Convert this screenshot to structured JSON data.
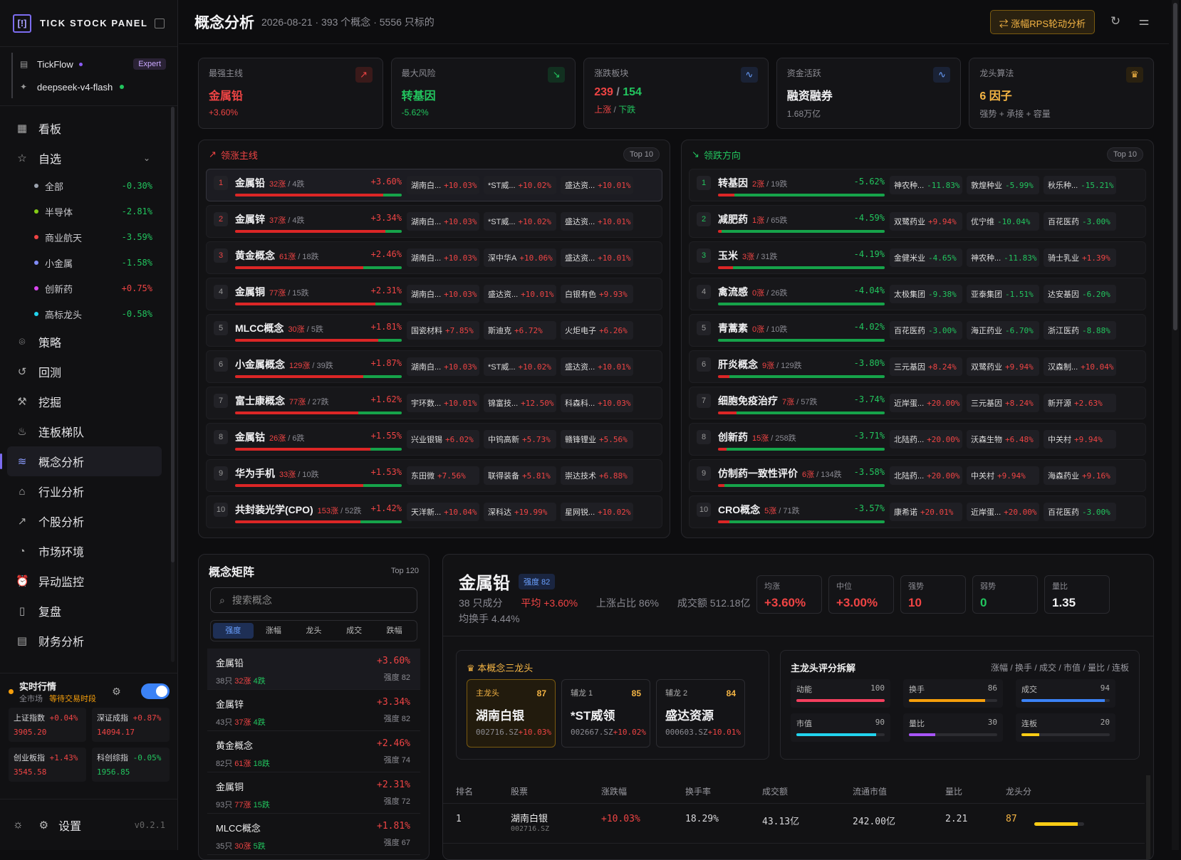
{
  "brand": {
    "logo": "[!]",
    "name": "TICK STOCK PANEL"
  },
  "accounts": [
    {
      "icon": "db-icon",
      "name": "TickFlow",
      "badge": "Expert"
    },
    {
      "icon": "model-icon",
      "name": "deepseek-v4-flash"
    }
  ],
  "nav": {
    "top": [
      {
        "icon": "grid-icon",
        "label": "看板"
      },
      {
        "icon": "star-icon",
        "label": "自选"
      }
    ],
    "watch": [
      {
        "label": "全部",
        "color": "#9ca3af",
        "value": "-0.30%"
      },
      {
        "label": "半导体",
        "color": "#84cc16",
        "value": "-2.81%"
      },
      {
        "label": "商业航天",
        "color": "#ef4444",
        "value": "-3.59%"
      },
      {
        "label": "小金属",
        "color": "#818cf8",
        "value": "-1.58%"
      },
      {
        "label": "创新药",
        "color": "#d946ef",
        "value": "+0.75%"
      },
      {
        "label": "高标龙头",
        "color": "#22d3ee",
        "value": "-0.58%"
      }
    ],
    "rest": [
      {
        "icon": "strategy-icon",
        "label": "策略"
      },
      {
        "icon": "history-icon",
        "label": "回测"
      },
      {
        "icon": "mining-icon",
        "label": "挖掘"
      },
      {
        "icon": "fire-icon",
        "label": "连板梯队"
      },
      {
        "icon": "layers-icon",
        "label": "概念分析"
      },
      {
        "icon": "bank-icon",
        "label": "行业分析"
      },
      {
        "icon": "trend-icon",
        "label": "个股分析"
      },
      {
        "icon": "gauge-icon",
        "label": "市场环境"
      },
      {
        "icon": "alarm-icon",
        "label": "异动监控"
      },
      {
        "icon": "book-icon",
        "label": "复盘"
      },
      {
        "icon": "file-icon",
        "label": "财务分析"
      }
    ],
    "active": "概念分析"
  },
  "realtime": {
    "title": "实时行情",
    "scope": "全市场",
    "status": "等待交易时段",
    "indices": [
      {
        "name": "上证指数",
        "chg": "+0.04%",
        "val": "3905.20"
      },
      {
        "name": "深证成指",
        "chg": "+0.87%",
        "val": "14094.17"
      },
      {
        "name": "创业板指",
        "chg": "+1.43%",
        "val": "3545.58"
      },
      {
        "name": "科创综指",
        "chg": "-0.05%",
        "val": "1956.85"
      }
    ]
  },
  "footer": {
    "settings": "设置",
    "version": "v0.2.1"
  },
  "header": {
    "title": "概念分析",
    "meta": "2026-08-21 · 393 个概念 · 5556 只标的",
    "rps_button": "涨幅RPS轮动分析"
  },
  "cards": [
    {
      "label": "最强主线",
      "value": "金属铅",
      "sub": "+3.60%",
      "icon": "up-trend-icon",
      "vcolor": "#ef4444",
      "scolor": "#ef4444"
    },
    {
      "label": "最大风险",
      "value": "转基因",
      "sub": "-5.62%",
      "icon": "down-trend-icon",
      "vcolor": "#22c55e",
      "scolor": "#22c55e"
    },
    {
      "label": "涨跌板块",
      "value": "239 / 154",
      "up": "239",
      "down": "154",
      "sub_up": "上涨",
      "sub_down": "下跌",
      "icon": "pulse-icon"
    },
    {
      "label": "资金活跃",
      "value": "融资融券",
      "sub": "1.68万亿",
      "icon": "pulse-icon",
      "vcolor": "#f1f1f3",
      "scolor": "#8c8c93"
    },
    {
      "label": "龙头算法",
      "value": "6 因子",
      "sub": "强势 + 承接 + 容量",
      "icon": "crown-icon",
      "vcolor": "#f5b544",
      "scolor": "#8c8c93"
    }
  ],
  "leaders": {
    "title": "领涨主线",
    "top": "Top 10",
    "rows": [
      {
        "rank": "1",
        "name": "金属铅",
        "up": "32涨",
        "down": "4跌",
        "pct": "+3.60%",
        "ratio": 0.89,
        "stocks": [
          [
            "湖南白...",
            "+10.03%"
          ],
          [
            "*ST威...",
            "+10.02%"
          ],
          [
            "盛达资...",
            "+10.01%"
          ]
        ]
      },
      {
        "rank": "2",
        "name": "金属锌",
        "up": "37涨",
        "down": "4跌",
        "pct": "+3.34%",
        "ratio": 0.9,
        "stocks": [
          [
            "湖南白...",
            "+10.03%"
          ],
          [
            "*ST威...",
            "+10.02%"
          ],
          [
            "盛达资...",
            "+10.01%"
          ]
        ]
      },
      {
        "rank": "3",
        "name": "黄金概念",
        "up": "61涨",
        "down": "18跌",
        "pct": "+2.46%",
        "ratio": 0.77,
        "stocks": [
          [
            "湖南白...",
            "+10.03%"
          ],
          [
            "深中华A",
            "+10.06%"
          ],
          [
            "盛达资...",
            "+10.01%"
          ]
        ]
      },
      {
        "rank": "4",
        "name": "金属铜",
        "up": "77涨",
        "down": "15跌",
        "pct": "+2.31%",
        "ratio": 0.84,
        "stocks": [
          [
            "湖南白...",
            "+10.03%"
          ],
          [
            "盛达资...",
            "+10.01%"
          ],
          [
            "白银有色",
            "+9.93%"
          ]
        ]
      },
      {
        "rank": "5",
        "name": "MLCC概念",
        "up": "30涨",
        "down": "5跌",
        "pct": "+1.81%",
        "ratio": 0.86,
        "stocks": [
          [
            "国瓷材料",
            "+7.85%"
          ],
          [
            "斯迪克",
            "+6.72%"
          ],
          [
            "火炬电子",
            "+6.26%"
          ]
        ]
      },
      {
        "rank": "6",
        "name": "小金属概念",
        "up": "129涨",
        "down": "39跌",
        "pct": "+1.87%",
        "ratio": 0.77,
        "stocks": [
          [
            "湖南白...",
            "+10.03%"
          ],
          [
            "*ST威...",
            "+10.02%"
          ],
          [
            "盛达资...",
            "+10.01%"
          ]
        ]
      },
      {
        "rank": "7",
        "name": "富士康概念",
        "up": "77涨",
        "down": "27跌",
        "pct": "+1.62%",
        "ratio": 0.74,
        "stocks": [
          [
            "宇环数...",
            "+10.01%"
          ],
          [
            "锦富技...",
            "+12.50%"
          ],
          [
            "科森科...",
            "+10.03%"
          ]
        ]
      },
      {
        "rank": "8",
        "name": "金属钴",
        "up": "26涨",
        "down": "6跌",
        "pct": "+1.55%",
        "ratio": 0.81,
        "stocks": [
          [
            "兴业银锡",
            "+6.02%"
          ],
          [
            "中钨高新",
            "+5.73%"
          ],
          [
            "赣锋锂业",
            "+5.56%"
          ]
        ]
      },
      {
        "rank": "9",
        "name": "华为手机",
        "up": "33涨",
        "down": "10跌",
        "pct": "+1.53%",
        "ratio": 0.77,
        "stocks": [
          [
            "东田微",
            "+7.56%"
          ],
          [
            "联得装备",
            "+5.81%"
          ],
          [
            "崇达技术",
            "+6.88%"
          ]
        ]
      },
      {
        "rank": "10",
        "name": "共封装光学(CPO)",
        "up": "153涨",
        "down": "52跌",
        "pct": "+1.42%",
        "ratio": 0.75,
        "stocks": [
          [
            "天洋新...",
            "+10.04%"
          ],
          [
            "深科达",
            "+19.99%"
          ],
          [
            "星网锐...",
            "+10.02%"
          ]
        ]
      }
    ]
  },
  "losers": {
    "title": "领跌方向",
    "top": "Top 10",
    "rows": [
      {
        "rank": "1",
        "name": "转基因",
        "up": "2涨",
        "down": "19跌",
        "pct": "-5.62%",
        "ratio": 0.1,
        "stocks": [
          [
            "神农种...",
            "-11.83%"
          ],
          [
            "敦煌种业",
            "-5.99%"
          ],
          [
            "秋乐种...",
            "-15.21%"
          ]
        ]
      },
      {
        "rank": "2",
        "name": "减肥药",
        "up": "1涨",
        "down": "65跌",
        "pct": "-4.59%",
        "ratio": 0.02,
        "stocks": [
          [
            "双鹭药业",
            "+9.94%"
          ],
          [
            "优宁维",
            "-10.04%"
          ],
          [
            "百花医药",
            "-3.00%"
          ]
        ]
      },
      {
        "rank": "3",
        "name": "玉米",
        "up": "3涨",
        "down": "31跌",
        "pct": "-4.19%",
        "ratio": 0.09,
        "stocks": [
          [
            "金健米业",
            "-4.65%"
          ],
          [
            "神农种...",
            "-11.83%"
          ],
          [
            "骑士乳业",
            "+1.39%"
          ]
        ]
      },
      {
        "rank": "4",
        "name": "禽流感",
        "up": "0涨",
        "down": "26跌",
        "pct": "-4.04%",
        "ratio": 0.0,
        "stocks": [
          [
            "太极集团",
            "-9.38%"
          ],
          [
            "亚泰集团",
            "-1.51%"
          ],
          [
            "达安基因",
            "-6.20%"
          ]
        ]
      },
      {
        "rank": "5",
        "name": "青蒿素",
        "up": "0涨",
        "down": "10跌",
        "pct": "-4.02%",
        "ratio": 0.0,
        "stocks": [
          [
            "百花医药",
            "-3.00%"
          ],
          [
            "海正药业",
            "-6.70%"
          ],
          [
            "浙江医药",
            "-8.88%"
          ]
        ]
      },
      {
        "rank": "6",
        "name": "肝炎概念",
        "up": "9涨",
        "down": "129跌",
        "pct": "-3.80%",
        "ratio": 0.07,
        "stocks": [
          [
            "三元基因",
            "+8.24%"
          ],
          [
            "双鹭药业",
            "+9.94%"
          ],
          [
            "汉森制...",
            "+10.04%"
          ]
        ]
      },
      {
        "rank": "7",
        "name": "细胞免疫治疗",
        "up": "7涨",
        "down": "57跌",
        "pct": "-3.74%",
        "ratio": 0.11,
        "stocks": [
          [
            "近岸蛋...",
            "+20.00%"
          ],
          [
            "三元基因",
            "+8.24%"
          ],
          [
            "新开源",
            "+2.63%"
          ]
        ]
      },
      {
        "rank": "8",
        "name": "创新药",
        "up": "15涨",
        "down": "258跌",
        "pct": "-3.71%",
        "ratio": 0.05,
        "stocks": [
          [
            "北陆药...",
            "+20.00%"
          ],
          [
            "沃森生物",
            "+6.48%"
          ],
          [
            "中关村",
            "+9.94%"
          ]
        ]
      },
      {
        "rank": "9",
        "name": "仿制药一致性评价",
        "up": "6涨",
        "down": "134跌",
        "pct": "-3.58%",
        "ratio": 0.04,
        "stocks": [
          [
            "北陆药...",
            "+20.00%"
          ],
          [
            "中关村",
            "+9.94%"
          ],
          [
            "海森药业",
            "+9.16%"
          ]
        ]
      },
      {
        "rank": "10",
        "name": "CRO概念",
        "up": "5涨",
        "down": "71跌",
        "pct": "-3.57%",
        "ratio": 0.07,
        "stocks": [
          [
            "康希诺",
            "+20.01%"
          ],
          [
            "近岸蛋...",
            "+20.00%"
          ],
          [
            "百花医药",
            "-3.00%"
          ]
        ]
      }
    ]
  },
  "matrix": {
    "title": "概念矩阵",
    "top": "Top 120",
    "search_placeholder": "搜索概念",
    "tabs": [
      "强度",
      "涨幅",
      "龙头",
      "成交",
      "跌幅"
    ],
    "active_tab": "强度",
    "items": [
      {
        "name": "金属铅",
        "pct": "+3.60%",
        "count": "38只",
        "up": "32涨",
        "down": "4跌",
        "strength": "强度 82"
      },
      {
        "name": "金属锌",
        "pct": "+3.34%",
        "count": "43只",
        "up": "37涨",
        "down": "4跌",
        "strength": "强度 82"
      },
      {
        "name": "黄金概念",
        "pct": "+2.46%",
        "count": "82只",
        "up": "61涨",
        "down": "18跌",
        "strength": "强度 74"
      },
      {
        "name": "金属铜",
        "pct": "+2.31%",
        "count": "93只",
        "up": "77涨",
        "down": "15跌",
        "strength": "强度 72"
      },
      {
        "name": "MLCC概念",
        "pct": "+1.81%",
        "count": "35只",
        "up": "30涨",
        "down": "5跌",
        "strength": "强度 67"
      }
    ]
  },
  "detail": {
    "name": "金属铅",
    "strength_badge": "强度 82",
    "line1": {
      "count": "38 只成分",
      "avg": "平均 +3.60%",
      "up_ratio": "上涨占比 86%",
      "turnover": "成交额 512.18亿"
    },
    "line2": "均换手 4.44%",
    "stats": [
      {
        "label": "均涨",
        "value": "+3.60%",
        "color": "#ef4444"
      },
      {
        "label": "中位",
        "value": "+3.00%",
        "color": "#ef4444"
      },
      {
        "label": "强势",
        "value": "10",
        "color": "#ef4444"
      },
      {
        "label": "弱势",
        "value": "0",
        "color": "#22c55e"
      },
      {
        "label": "量比",
        "value": "1.35",
        "color": "#f1f1f3"
      }
    ],
    "dragons_title": "本概念三龙头",
    "dragons": [
      {
        "tag": "主龙头",
        "score": "87",
        "name": "湖南白银",
        "code": "002716.SZ",
        "pct": "+10.03%"
      },
      {
        "tag": "辅龙 1",
        "score": "85",
        "name": "*ST威领",
        "code": "002667.SZ",
        "pct": "+10.02%"
      },
      {
        "tag": "辅龙 2",
        "score": "84",
        "name": "盛达资源",
        "code": "000603.SZ",
        "pct": "+10.01%"
      }
    ],
    "factor_title": "主龙头评分拆解",
    "factor_legend": "涨幅 / 换手 / 成交 / 市值 / 量比 / 连板",
    "factors": [
      {
        "label": "动能",
        "value": "100",
        "fill": 1.0,
        "color": "#f43f5e"
      },
      {
        "label": "换手",
        "value": "86",
        "fill": 0.86,
        "color": "#f59e0b"
      },
      {
        "label": "成交",
        "value": "94",
        "fill": 0.94,
        "color": "#3b82f6"
      },
      {
        "label": "市值",
        "value": "90",
        "fill": 0.9,
        "color": "#22d3ee"
      },
      {
        "label": "量比",
        "value": "30",
        "fill": 0.3,
        "color": "#a855f7"
      },
      {
        "label": "连板",
        "value": "20",
        "fill": 0.2,
        "color": "#facc15"
      }
    ],
    "table": {
      "headers": [
        "排名",
        "股票",
        "涨跌幅",
        "换手率",
        "成交额",
        "流通市值",
        "量比",
        "龙头分"
      ],
      "row": {
        "rank": "1",
        "name": "湖南白银",
        "code": "002716.SZ",
        "chg": "+10.03%",
        "turnover": "18.29%",
        "amount": "43.13亿",
        "cap": "242.00亿",
        "vr": "2.21",
        "score": "87",
        "score_fill": 0.87
      }
    }
  }
}
